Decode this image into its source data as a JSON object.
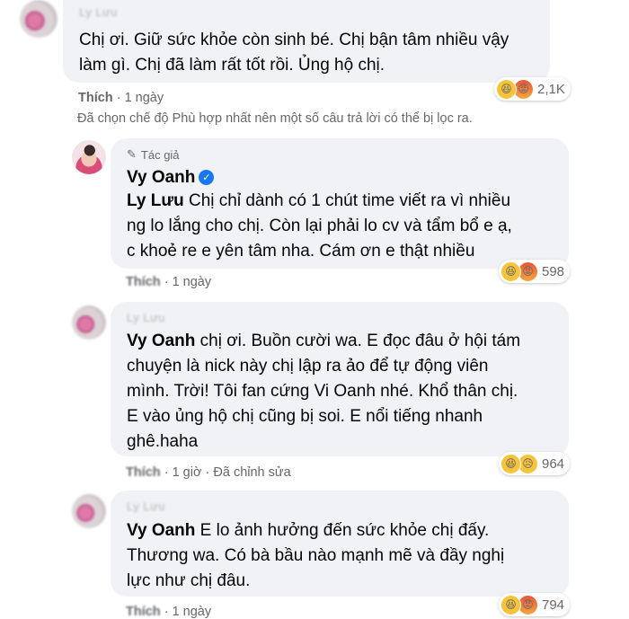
{
  "comments": [
    {
      "author": "Ly Lưu",
      "text": "Chị ơi. Giữ sức khỏe còn sinh bé. Chị bận tâm nhiều vậy làm gì. Chị đã làm rất tốt rồi. Ủng hộ chị.",
      "line1": "Chị ơi. Giữ sức khỏe còn sinh bé. Chị bận tâm nhiều vậy",
      "line2": "làm gì. Chị đã làm rất tốt rồi. Ủng hộ chị.",
      "like": "Thích",
      "time": "1 ngày",
      "reaction_count": "2,1K"
    },
    {
      "author_badge": "Tác giả",
      "author": "Vy Oanh",
      "mention": "Ly Lưu",
      "line1": " Chị chỉ dành có 1 chút time viết ra vì nhiều",
      "line2": "ng lo lắng cho chị. Còn lại phải lo cv và tẩm bổ e ạ,",
      "line3": "c khoẻ re e yên tâm nha. Cám ơn e thật nhiều",
      "like": "Thích",
      "time": "1 ngày",
      "reaction_count": "598"
    },
    {
      "author": "Ly Lưu",
      "mention": "Vy Oanh",
      "line1": " chị ơi. Buồn cười wa. E đọc đâu ở hội tám",
      "line2": "chuyện là nick này chị lập ra ảo để tự động viên",
      "line3": "mình. Trời! Tôi fan cứng Vi Oanh nhé. Khổ thân chị.",
      "line4": "E vào ủng hộ chị cũng bị soi. E nổi tiếng nhanh",
      "line5": "ghê.haha",
      "like": "Thích",
      "time": "1 giờ",
      "edited": "Đã chỉnh sửa",
      "reaction_count": "964"
    },
    {
      "author": "Ly Lưu",
      "mention": "Vy Oanh",
      "line1": " E lo ảnh hưởng đến sức khỏe chị đấy.",
      "line2": "Thương wa. Có bà bầu nào mạnh mẽ và đầy nghị",
      "line3": "lực như chị đâu.",
      "like": "Thích",
      "time": "1 ngày",
      "reaction_count": "794"
    }
  ],
  "filter_note": "Đã chọn chế độ Phù hợp nhất nên một số câu trả lời có thể bị lọc ra.",
  "separator": "·",
  "icons": {
    "haha": "haha-reaction-icon",
    "angry": "angry-reaction-icon",
    "sad": "sad-reaction-icon",
    "pen": "pen-icon",
    "verified": "verified-badge-icon"
  },
  "colors": {
    "bubble": "#f0f2f5",
    "meta": "#65676b",
    "verified": "#1877f2"
  }
}
